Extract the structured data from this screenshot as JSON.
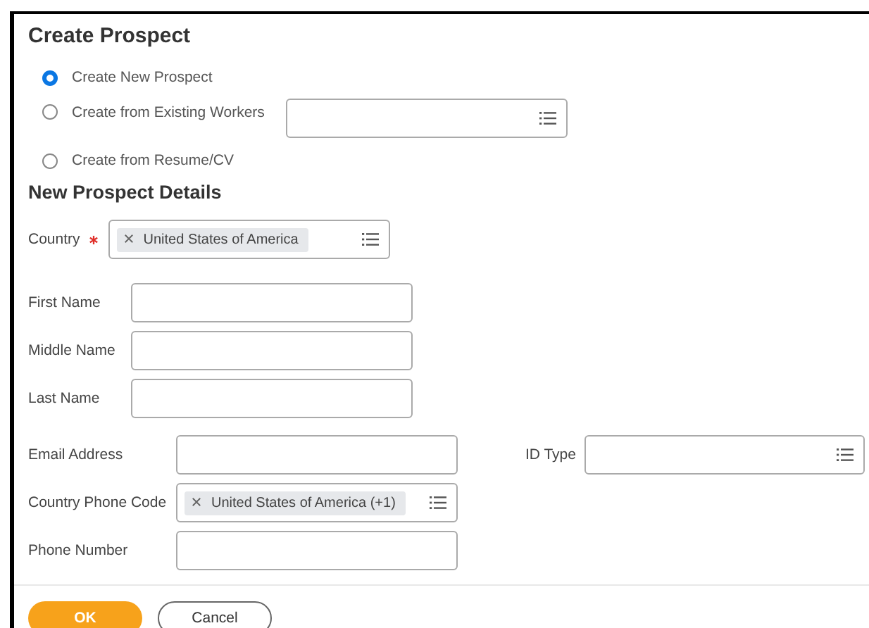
{
  "title": "Create Prospect",
  "radios": [
    {
      "label": "Create New Prospect",
      "selected": true,
      "kind": "plain"
    },
    {
      "label": "Create from Existing Workers",
      "selected": false,
      "kind": "with_prompt"
    },
    {
      "label": "Create from Resume/CV",
      "selected": false,
      "kind": "plain"
    }
  ],
  "section_title": "New Prospect Details",
  "country": {
    "label": "Country",
    "required": true,
    "chip": "United States of America"
  },
  "name_fields": [
    {
      "label": "First Name"
    },
    {
      "label": "Middle Name"
    },
    {
      "label": "Last Name"
    }
  ],
  "contact_fields": [
    {
      "label": "Email Address",
      "kind": "text"
    },
    {
      "label": "Country Phone Code",
      "kind": "prompt",
      "chip": "United States of America (+1)"
    },
    {
      "label": "Phone Number",
      "kind": "text"
    }
  ],
  "id_type": {
    "label": "ID Type"
  },
  "buttons": [
    {
      "label": "OK",
      "kind": "primary"
    },
    {
      "label": "Cancel",
      "kind": "secondary"
    }
  ]
}
